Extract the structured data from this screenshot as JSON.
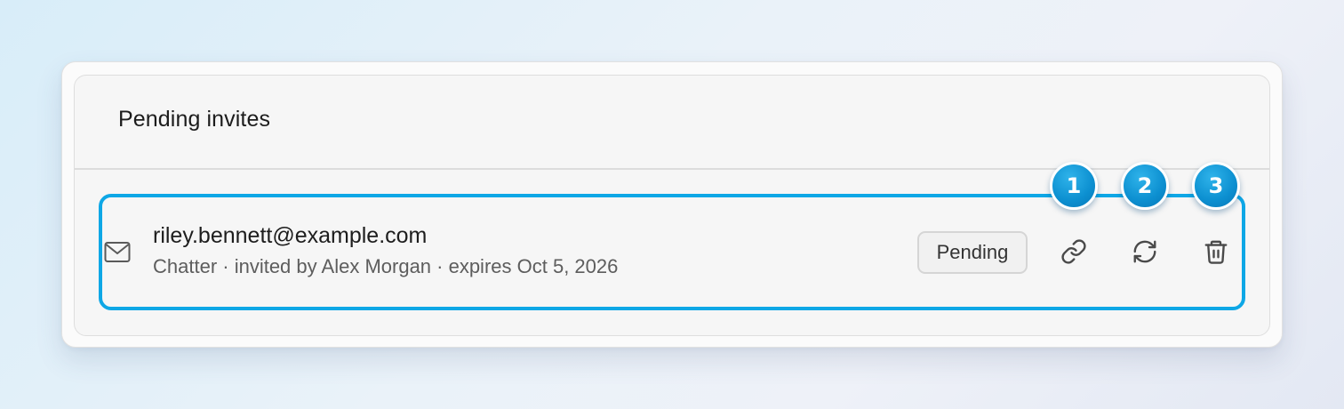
{
  "panel": {
    "title": "Pending invites"
  },
  "invite": {
    "icon": "mail-icon",
    "email": "riley.bennett@example.com",
    "details": "Chatter · invited by Alex Morgan · expires Oct 5, 2026",
    "status": "Pending",
    "actions": [
      {
        "name": "copy-link",
        "icon": "link-icon"
      },
      {
        "name": "resend",
        "icon": "refresh-icon"
      },
      {
        "name": "delete",
        "icon": "trash-icon"
      }
    ]
  },
  "step_markers": [
    "1",
    "2",
    "3"
  ],
  "colors": {
    "highlight": "#0ea7e6",
    "marker": "#0c8fd0",
    "text_primary": "#1d1d1d",
    "text_secondary": "#5d5d5d"
  }
}
